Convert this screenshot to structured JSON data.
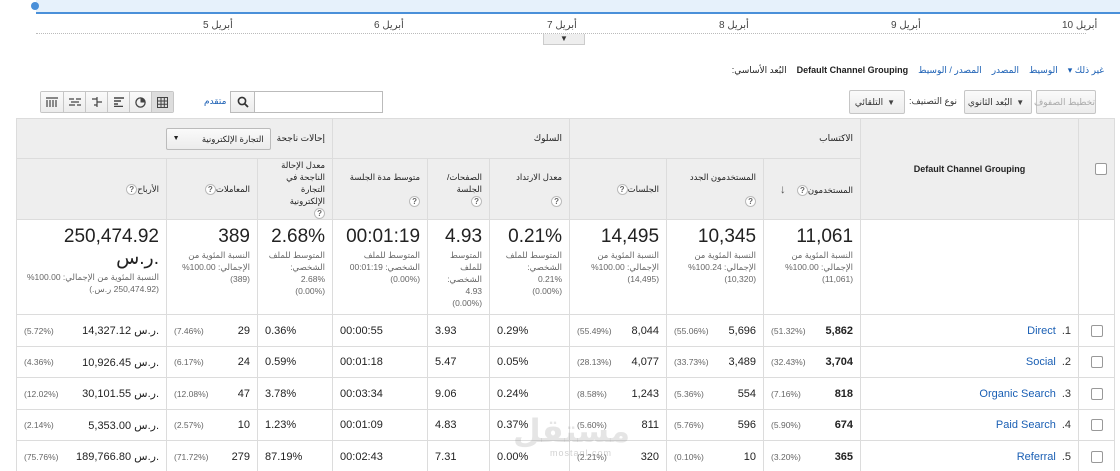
{
  "timeline": {
    "ticks": [
      "أبريل 5",
      "أبريل 6",
      "أبريل 7",
      "أبريل 8",
      "أبريل 9",
      "أبريل 10"
    ]
  },
  "primary_dimension": {
    "label": "البُعد الأساسي:",
    "current": "Default Channel Grouping",
    "links": [
      "المصدر / الوسيط",
      "المصدر",
      "الوسيط"
    ],
    "more": "غير ذلك"
  },
  "toolbar": {
    "plot_rows": "تخطيط الصفوف",
    "secondary_dimension": "البُعد الثانوي",
    "sort_type_label": "نوع التصنيف:",
    "sort_type_value": "التلقائي",
    "search_placeholder": "",
    "advanced": "متقدم",
    "view_icons": [
      "table-view",
      "pie-view",
      "performance-view",
      "comparison-view",
      "term-cloud-view",
      "pivot-view"
    ]
  },
  "table": {
    "dimension_header": "Default Channel Grouping",
    "groups": {
      "acquisition": "الاكتساب",
      "behavior": "السلوك",
      "conversions": "إحالات ناجحة",
      "conversions_select": "التجارة الإلكترونية"
    },
    "headers": {
      "users": "المستخدمون",
      "new_users": "المستخدمون الجدد",
      "sessions": "الجلسات",
      "bounce_rate": "معدل الارتداد",
      "pages_session": "الصفحات/ الجلسة",
      "avg_duration": "متوسط مدة الجلسة",
      "ecom_rate": "معدل الإحالة الناجحة في التجارة الإلكترونية",
      "transactions": "المعاملات",
      "revenue": "الأرباح"
    },
    "totals": {
      "users": {
        "value": "11,061",
        "sub1": "النسبة المئوية من",
        "sub2": "الإجمالي: 100.00%",
        "sub3": "(11,061)"
      },
      "new_users": {
        "value": "10,345",
        "sub1": "النسبة المئوية من",
        "sub2": "الإجمالي: 100.24%",
        "sub3": "(10,320)"
      },
      "sessions": {
        "value": "14,495",
        "sub1": "النسبة المئوية من",
        "sub2": "الإجمالي: 100.00%",
        "sub3": "(14,495)"
      },
      "bounce_rate": {
        "value": "0.21%",
        "sub1": "المتوسط للملف",
        "sub2": "الشخصي:",
        "sub3": "0.21%",
        "sub4": "(0.00%)"
      },
      "pages_session": {
        "value": "4.93",
        "sub1": "المتوسط",
        "sub2": "للملف",
        "sub3": "الشخصي:",
        "sub4": "4.93",
        "sub5": "(0.00%)"
      },
      "avg_duration": {
        "value": "00:01:19",
        "sub1": "المتوسط للملف",
        "sub2": "الشخصي: 00:01:19",
        "sub3": "(0.00%)"
      },
      "ecom_rate": {
        "value": "2.68%",
        "sub1": "المتوسط للملف",
        "sub2": "الشخصي:",
        "sub3": "2.68%",
        "sub4": "(0.00%)"
      },
      "transactions": {
        "value": "389",
        "sub1": "النسبة المئوية من",
        "sub2": "الإجمالي: 100.00%",
        "sub3": "(389)"
      },
      "revenue": {
        "value": "250,474.92 ر.س.",
        "sub1": "النسبة المئوية من الإجمالي: 100.00%",
        "sub2": "(250,474.92 ر.س.)"
      }
    },
    "rows": [
      {
        "idx": "1.",
        "channel": "Direct",
        "users": "5,862",
        "users_pct": "(51.32%)",
        "new_users": "5,696",
        "new_users_pct": "(55.06%)",
        "sessions": "8,044",
        "sessions_pct": "(55.49%)",
        "bounce": "0.29%",
        "pages": "3.93",
        "duration": "00:00:55",
        "ecom_rate": "0.36%",
        "transactions": "29",
        "transactions_pct": "(7.46%)",
        "revenue": "14,327.12 ر.س.",
        "revenue_pct": "(5.72%)"
      },
      {
        "idx": "2.",
        "channel": "Social",
        "users": "3,704",
        "users_pct": "(32.43%)",
        "new_users": "3,489",
        "new_users_pct": "(33.73%)",
        "sessions": "4,077",
        "sessions_pct": "(28.13%)",
        "bounce": "0.05%",
        "pages": "5.47",
        "duration": "00:01:18",
        "ecom_rate": "0.59%",
        "transactions": "24",
        "transactions_pct": "(6.17%)",
        "revenue": "10,926.45 ر.س.",
        "revenue_pct": "(4.36%)"
      },
      {
        "idx": "3.",
        "channel": "Organic Search",
        "users": "818",
        "users_pct": "(7.16%)",
        "new_users": "554",
        "new_users_pct": "(5.36%)",
        "sessions": "1,243",
        "sessions_pct": "(8.58%)",
        "bounce": "0.24%",
        "pages": "9.06",
        "duration": "00:03:34",
        "ecom_rate": "3.78%",
        "transactions": "47",
        "transactions_pct": "(12.08%)",
        "revenue": "30,101.55 ر.س.",
        "revenue_pct": "(12.02%)"
      },
      {
        "idx": "4.",
        "channel": "Paid Search",
        "users": "674",
        "users_pct": "(5.90%)",
        "new_users": "596",
        "new_users_pct": "(5.76%)",
        "sessions": "811",
        "sessions_pct": "(5.60%)",
        "bounce": "0.37%",
        "pages": "4.83",
        "duration": "00:01:09",
        "ecom_rate": "1.23%",
        "transactions": "10",
        "transactions_pct": "(2.57%)",
        "revenue": "5,353.00 ر.س.",
        "revenue_pct": "(2.14%)"
      },
      {
        "idx": "5.",
        "channel": "Referral",
        "users": "365",
        "users_pct": "(3.20%)",
        "new_users": "10",
        "new_users_pct": "(0.10%)",
        "sessions": "320",
        "sessions_pct": "(2.21%)",
        "bounce": "0.00%",
        "pages": "7.31",
        "duration": "00:02:43",
        "ecom_rate": "87.19%",
        "transactions": "279",
        "transactions_pct": "(71.72%)",
        "revenue": "189,766.80 ر.س.",
        "revenue_pct": "(75.76%)"
      }
    ]
  },
  "watermark": {
    "text": "مستقل",
    "sub": "mostaql.com"
  },
  "colors": {
    "accent": "#4a90d9",
    "link": "#1a5fb4",
    "header_bg": "#eeeeee"
  }
}
